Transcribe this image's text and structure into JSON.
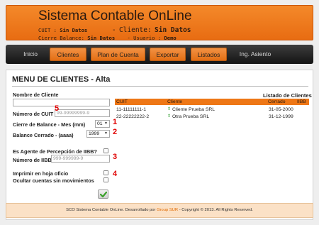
{
  "header": {
    "title": "Sistema Contable OnLine",
    "cuit_label": "CUIT :",
    "cuit_value": "Sin Datos",
    "separator": "-",
    "cliente_label": "Cliente:",
    "cliente_value": "Sin Datos",
    "cierre_label": "Cierre Balance:",
    "cierre_value": "Sin Datos",
    "usuario_label": "Usuario :",
    "usuario_value": "Demo"
  },
  "nav": {
    "items": [
      {
        "label": "Inicio",
        "highlighted": false
      },
      {
        "label": "Clientes",
        "highlighted": true
      },
      {
        "label": "Plan de Cuenta",
        "highlighted": true
      },
      {
        "label": "Exportar",
        "highlighted": true
      },
      {
        "label": "Listados",
        "highlighted": true
      },
      {
        "label": "Ing. Asiento",
        "highlighted": false
      }
    ]
  },
  "page_title": "MENU DE CLIENTES - Alta",
  "form": {
    "nombre_label": "Nombre de Cliente",
    "nombre_value": "",
    "cuit_label": "Número de CUIT",
    "cuit_placeholder": "99-99999999-9",
    "cierre_label": "Cierre de Balance - Mes (mm)",
    "cierre_value": "01",
    "balance_label": "Balance Cerrado - (aaaa)",
    "balance_value": "1999",
    "iibb_agent_label": "Es Agente de Percepción de IIBB?",
    "iibb_label": "Número de IIBB",
    "iibb_placeholder": "999-999999-9",
    "imprimir_label": "Imprimir en hoja oficio",
    "ocultar_label": "Ocultar cuentas sin movimientos"
  },
  "markers": [
    "1",
    "2",
    "3",
    "4",
    "5"
  ],
  "list": {
    "title": "Listado de Clientes",
    "headers": {
      "cuit": "CUIT",
      "cliente": "Cliente",
      "cerrado": "Cerrado",
      "iibb": "IIBB"
    },
    "rows": [
      {
        "cuit": "11-11111111-1",
        "cliente": "Cliente Prueba SRL",
        "cerrado": "31-05-2000",
        "iibb": ""
      },
      {
        "cuit": "22-22222222-2",
        "cliente": "Otra Prueba SRL",
        "cerrado": "31-12-1999",
        "iibb": ""
      }
    ]
  },
  "footer": {
    "text_before": "SCO Sistema Contable OnLine. Desarrollado por",
    "link": "Group SUR",
    "text_after": "- Copyright © 2013. All Rights Reserved."
  },
  "colors": {
    "accent": "#ee7716",
    "marker": "#e00000",
    "nav_bg": "#1e1e1e"
  },
  "icons": {
    "row_icon": "swap-arrows-icon",
    "submit_icon": "checkmark-icon",
    "select_icon": "chevron-down-icon"
  }
}
